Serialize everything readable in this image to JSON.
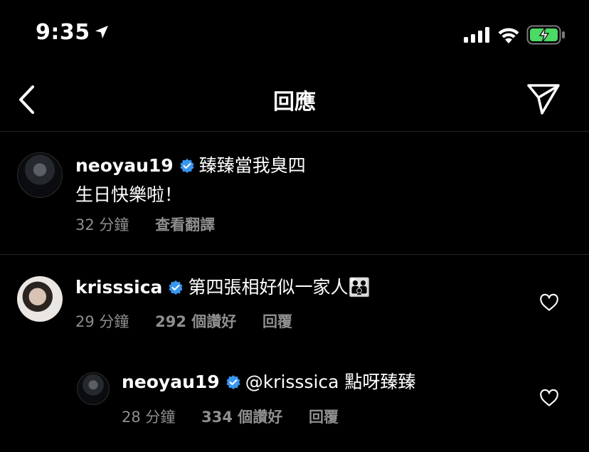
{
  "status_bar": {
    "time": "9:35"
  },
  "header": {
    "title": "回應"
  },
  "caption": {
    "username": "neoyau19",
    "text_line1": "臻臻當我臭四",
    "text_line2": "生日快樂啦！",
    "time_ago": "32 分鐘",
    "translate_label": "查看翻譯"
  },
  "comments": [
    {
      "username": "krisssica",
      "text": "第四張相好似一家人👨‍👨‍👦",
      "time_ago": "29 分鐘",
      "likes": "292 個讚好",
      "reply_label": "回覆"
    },
    {
      "username": "neoyau19",
      "mention": "@krisssica",
      "text": " 點呀臻臻",
      "time_ago": "28 分鐘",
      "likes": "334 個讚好",
      "reply_label": "回覆"
    }
  ],
  "colors": {
    "background": "#000000",
    "verified": "#3897f0",
    "battery_green": "#4cd964",
    "muted": "#8e8e8e"
  },
  "icons": [
    "location-arrow-icon",
    "signal-icon",
    "wifi-icon",
    "battery-icon",
    "back-icon",
    "send-icon",
    "verified-icon",
    "heart-icon"
  ]
}
